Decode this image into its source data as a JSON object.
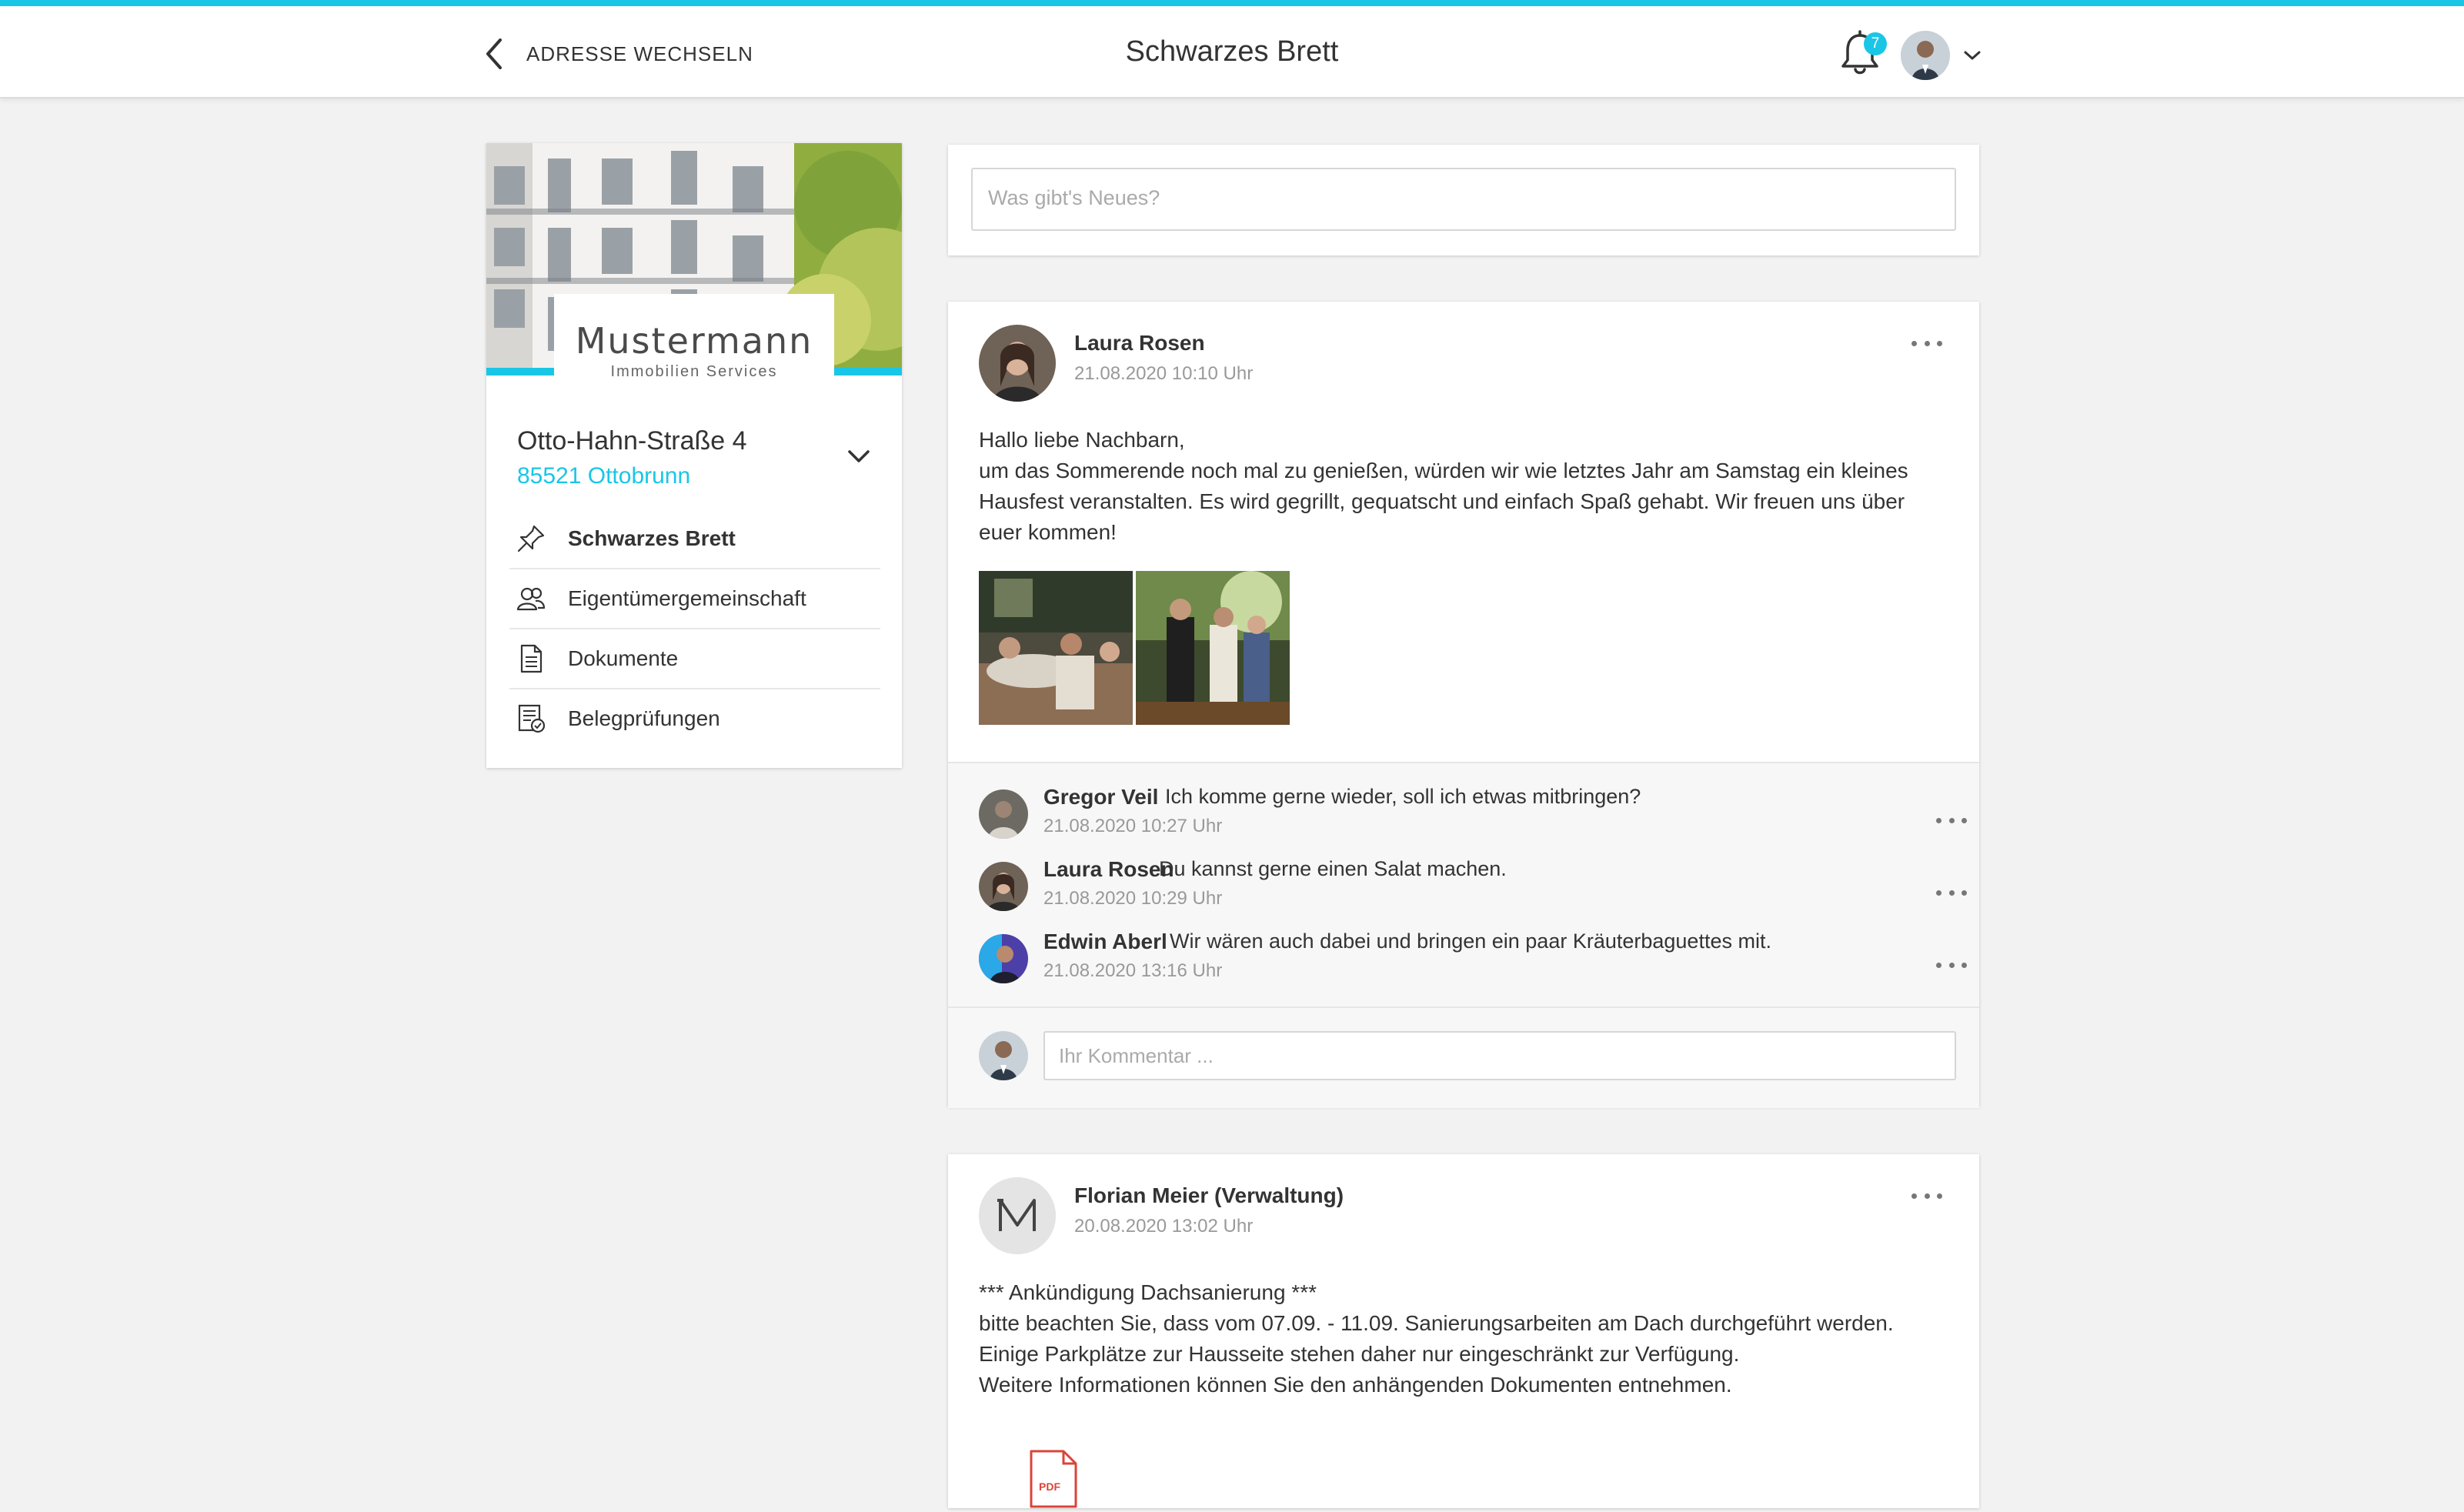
{
  "header": {
    "back_label": "ADRESSE WECHSELN",
    "title": "Schwarzes Brett",
    "notification_count": "7",
    "accent_color": "#19c6e6"
  },
  "property": {
    "logo_name": "Mustermann",
    "logo_sub": "Immobilien Services",
    "street": "Otto-Hahn-Straße 4",
    "city": "85521 Ottobrunn",
    "nav": [
      {
        "label": "Schwarzes Brett",
        "icon": "pin-icon",
        "active": true
      },
      {
        "label": "Eigentümergemeinschaft",
        "icon": "group-icon",
        "active": false
      },
      {
        "label": "Dokumente",
        "icon": "document-icon",
        "active": false
      },
      {
        "label": "Belegprüfungen",
        "icon": "receipt-check-icon",
        "active": false
      }
    ]
  },
  "composer": {
    "placeholder": "Was gibt's Neues?"
  },
  "posts": [
    {
      "author": "Laura Rosen",
      "date": "21.08.2020 10:10 Uhr",
      "body": [
        "Hallo liebe Nachbarn,",
        "um das Sommerende noch mal zu genießen, würden wir wie letztes Jahr am Samstag ein kleines",
        "Hausfest veranstalten. Es wird gegrillt, gequatscht und einfach Spaß gehabt. Wir freuen uns über",
        "euer kommen!"
      ],
      "comments": [
        {
          "author": "Gregor Veil",
          "text": "Ich komme gerne wieder, soll ich etwas mitbringen?",
          "date": "21.08.2020 10:27 Uhr"
        },
        {
          "author": "Laura Rosen",
          "text": "Du kannst gerne einen Salat machen.",
          "date": "21.08.2020 10:29 Uhr"
        },
        {
          "author": "Edwin Aberl",
          "text": "Wir wären auch dabei und bringen ein paar Kräuterbaguettes mit.",
          "date": "21.08.2020 13:16 Uhr"
        }
      ],
      "comment_placeholder": "Ihr Kommentar ..."
    },
    {
      "author": "Florian Meier (Verwaltung)",
      "date": "20.08.2020 13:02 Uhr",
      "body": [
        "*** Ankündigung Dachsanierung ***",
        "bitte beachten Sie, dass vom 07.09. - 11.09. Sanierungsarbeiten am Dach durchgeführt werden.",
        "Einige Parkplätze zur Hausseite stehen daher nur eingeschränkt zur Verfügung.",
        "Weitere Informationen können Sie den anhängenden Dokumenten entnehmen."
      ],
      "attachment_label": "PDF"
    }
  ]
}
